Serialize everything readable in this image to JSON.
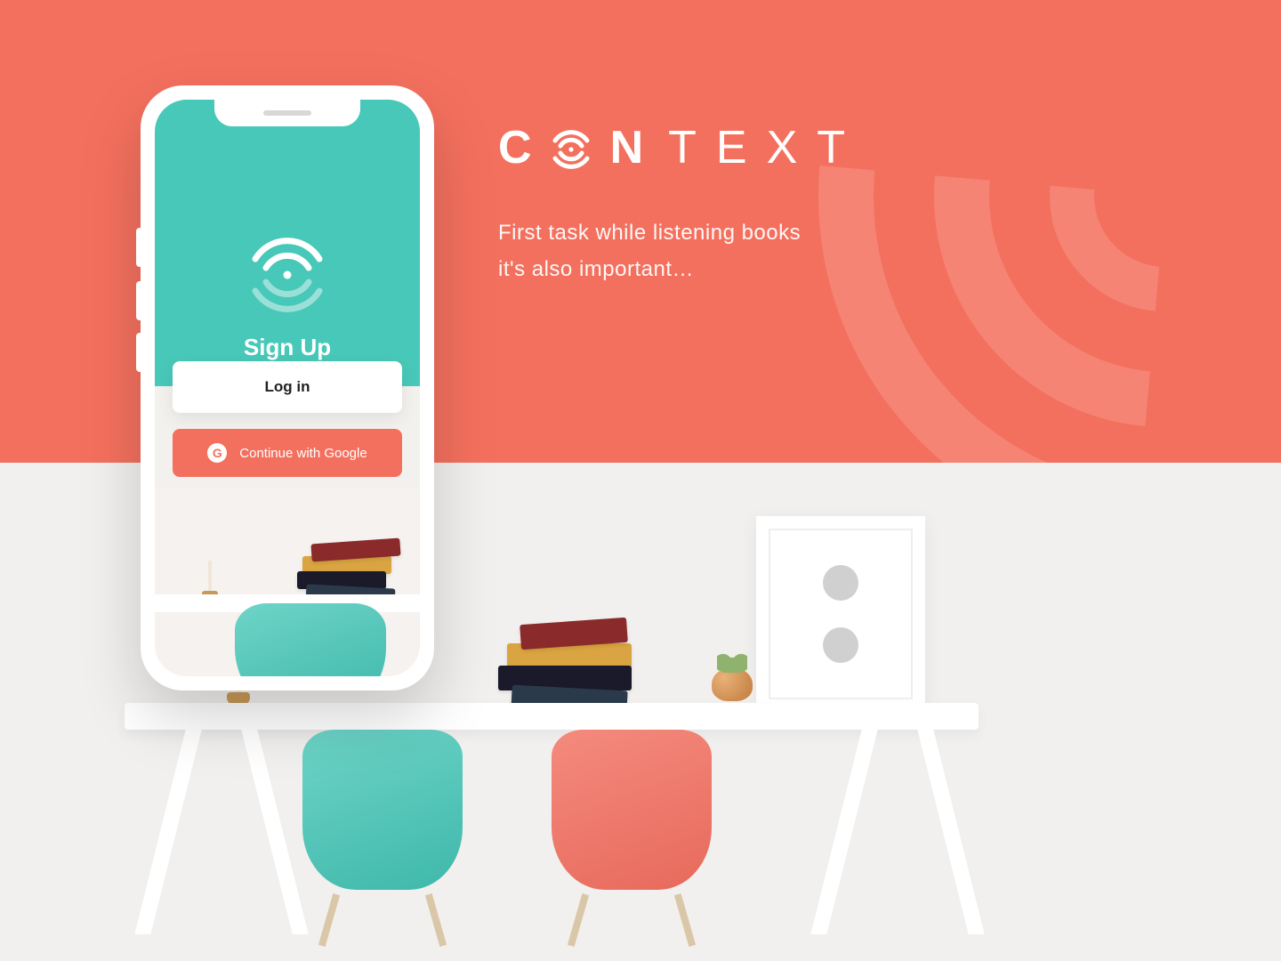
{
  "brand": {
    "name_part1": "C",
    "name_part2": "N",
    "name_part3": "TEXT",
    "tagline_line1": "First task while listening books",
    "tagline_line2": "it's also important…"
  },
  "phone": {
    "signup_title": "Sign Up",
    "login_label": "Log in",
    "google_label": "Continue with Google",
    "google_badge": "G"
  },
  "colors": {
    "coral": "#f4705e",
    "teal": "#48c8b8",
    "white": "#ffffff"
  }
}
